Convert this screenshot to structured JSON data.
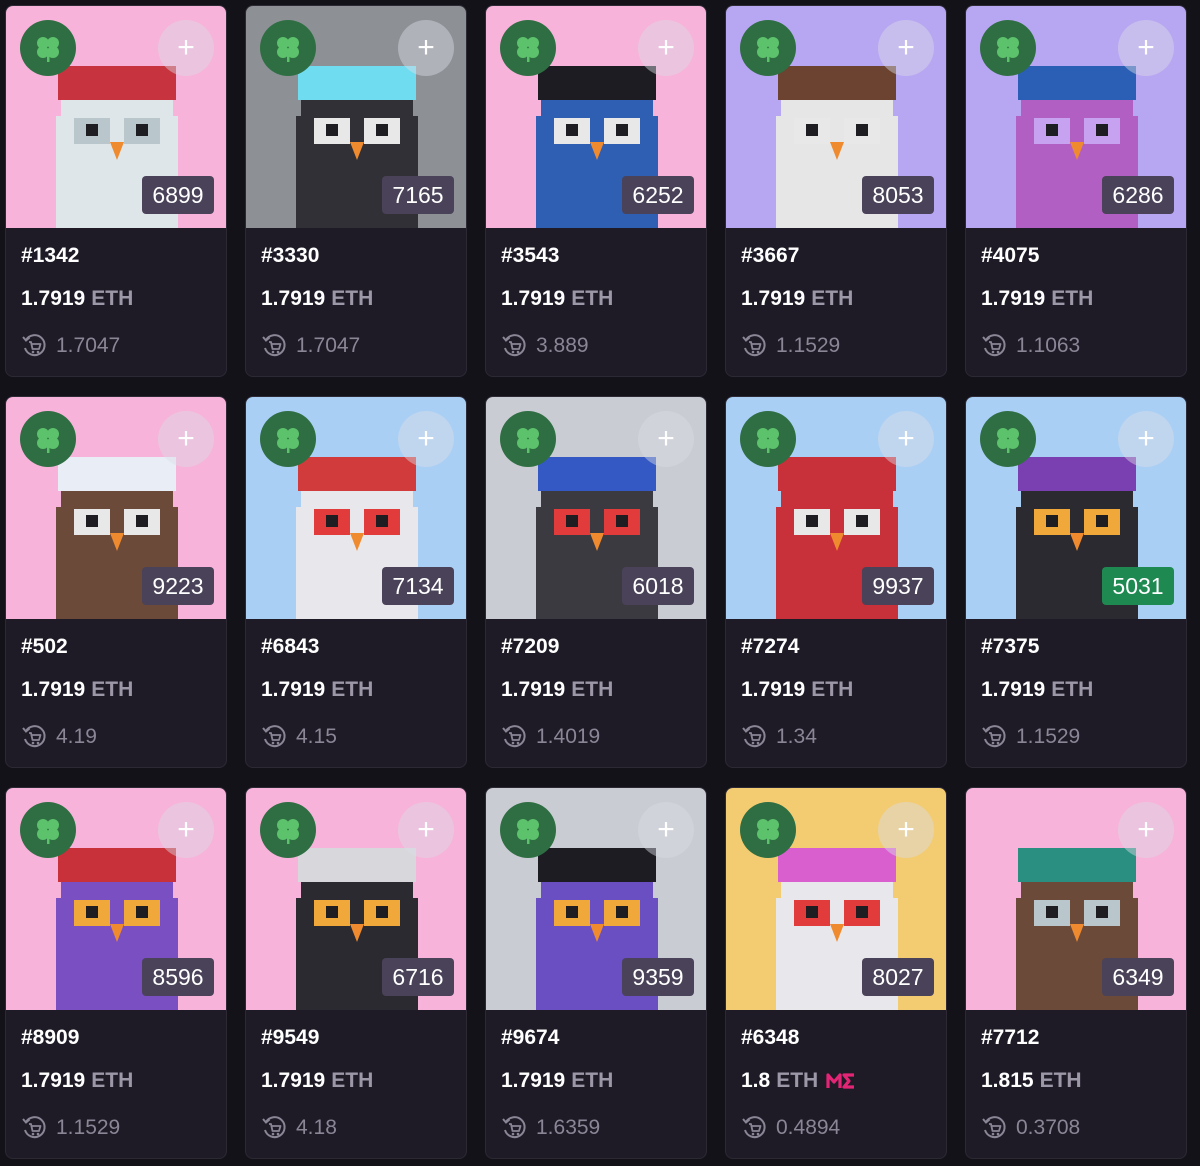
{
  "colors": {
    "page_bg": "#141219",
    "card_bg": "#1e1b26",
    "clover_badge": "#2f6e43",
    "rank_badge": "#4a4258",
    "rank_badge_highlight": "#1e8a52",
    "price_unit": "#9d98a8",
    "muted_text": "#8b8696",
    "magic_eden_logo": "#e42575"
  },
  "icons": {
    "clover": "four-leaf-clover-icon",
    "add": "plus-icon",
    "last_sale": "cart-refresh-icon",
    "marketplace": "magic-eden-logo"
  },
  "add_label": "+",
  "cards": [
    {
      "id": "#1342",
      "rank": "6899",
      "price": "1.7919",
      "unit": "ETH",
      "last": "1.7047",
      "bg": "#f7b3d9",
      "body": "#dfe6ea",
      "eye": "#b9c6cc",
      "accessory": "#c7343f",
      "clover": true,
      "me": false,
      "rank_highlight": false
    },
    {
      "id": "#3330",
      "rank": "7165",
      "price": "1.7919",
      "unit": "ETH",
      "last": "1.7047",
      "bg": "#8d9196",
      "body": "#303036",
      "eye": "#e8e8e8",
      "accessory": "#6fdcf0",
      "clover": true,
      "me": false,
      "rank_highlight": false
    },
    {
      "id": "#3543",
      "rank": "6252",
      "price": "1.7919",
      "unit": "ETH",
      "last": "3.889",
      "bg": "#f7b3d9",
      "body": "#2f5fb3",
      "eye": "#e8e8e8",
      "accessory": "#1c1c22",
      "clover": true,
      "me": false,
      "rank_highlight": false
    },
    {
      "id": "#3667",
      "rank": "8053",
      "price": "1.7919",
      "unit": "ETH",
      "last": "1.1529",
      "bg": "#b7a7f2",
      "body": "#e6e6e6",
      "eye": "#e8e8e8",
      "accessory": "#6b4330",
      "clover": true,
      "me": false,
      "rank_highlight": false
    },
    {
      "id": "#4075",
      "rank": "6286",
      "price": "1.7919",
      "unit": "ETH",
      "last": "1.1063",
      "bg": "#b7a7f2",
      "body": "#b25fc4",
      "eye": "#c6a2f0",
      "accessory": "#2b5fb5",
      "clover": true,
      "me": false,
      "rank_highlight": false
    },
    {
      "id": "#502",
      "rank": "9223",
      "price": "1.7919",
      "unit": "ETH",
      "last": "4.19",
      "bg": "#f7b3d9",
      "body": "#6b4a3a",
      "eye": "#e8e8e8",
      "accessory": "#e9eef6",
      "clover": true,
      "me": false,
      "rank_highlight": false
    },
    {
      "id": "#6843",
      "rank": "7134",
      "price": "1.7919",
      "unit": "ETH",
      "last": "4.15",
      "bg": "#a9cff5",
      "body": "#e8e8ec",
      "eye": "#e23b3b",
      "accessory": "#d23b3b",
      "clover": true,
      "me": false,
      "rank_highlight": false
    },
    {
      "id": "#7209",
      "rank": "6018",
      "price": "1.7919",
      "unit": "ETH",
      "last": "1.4019",
      "bg": "#c9ccd2",
      "body": "#3a3a40",
      "eye": "#e23b3b",
      "accessory": "#3459c4",
      "clover": true,
      "me": false,
      "rank_highlight": false
    },
    {
      "id": "#7274",
      "rank": "9937",
      "price": "1.7919",
      "unit": "ETH",
      "last": "1.34",
      "bg": "#a9cff5",
      "body": "#c8303a",
      "eye": "#e8e8e8",
      "accessory": "#c8303a",
      "clover": true,
      "me": false,
      "rank_highlight": false
    },
    {
      "id": "#7375",
      "rank": "5031",
      "price": "1.7919",
      "unit": "ETH",
      "last": "1.1529",
      "bg": "#a9cff5",
      "body": "#2a2a30",
      "eye": "#f0a83a",
      "accessory": "#7a3fb0",
      "clover": true,
      "me": false,
      "rank_highlight": true
    },
    {
      "id": "#8909",
      "rank": "8596",
      "price": "1.7919",
      "unit": "ETH",
      "last": "1.1529",
      "bg": "#f7b3d9",
      "body": "#7a4fc2",
      "eye": "#f0a83a",
      "accessory": "#c8303a",
      "clover": true,
      "me": false,
      "rank_highlight": false
    },
    {
      "id": "#9549",
      "rank": "6716",
      "price": "1.7919",
      "unit": "ETH",
      "last": "4.18",
      "bg": "#f7b3d9",
      "body": "#2a2a30",
      "eye": "#f0a83a",
      "accessory": "#d8d8dc",
      "clover": true,
      "me": false,
      "rank_highlight": false
    },
    {
      "id": "#9674",
      "rank": "9359",
      "price": "1.7919",
      "unit": "ETH",
      "last": "1.6359",
      "bg": "#c9ccd2",
      "body": "#6a4fc2",
      "eye": "#f0a83a",
      "accessory": "#1c1c22",
      "clover": true,
      "me": false,
      "rank_highlight": false
    },
    {
      "id": "#6348",
      "rank": "8027",
      "price": "1.8",
      "unit": "ETH",
      "last": "0.4894",
      "bg": "#f3cc72",
      "body": "#e8e8ec",
      "eye": "#e23b3b",
      "accessory": "#d95fcf",
      "clover": true,
      "me": true,
      "rank_highlight": false
    },
    {
      "id": "#7712",
      "rank": "6349",
      "price": "1.815",
      "unit": "ETH",
      "last": "0.3708",
      "bg": "#f7b3d9",
      "body": "#6b4a3a",
      "eye": "#b9c6cc",
      "accessory": "#2a8f80",
      "clover": false,
      "me": false,
      "rank_highlight": false
    }
  ]
}
